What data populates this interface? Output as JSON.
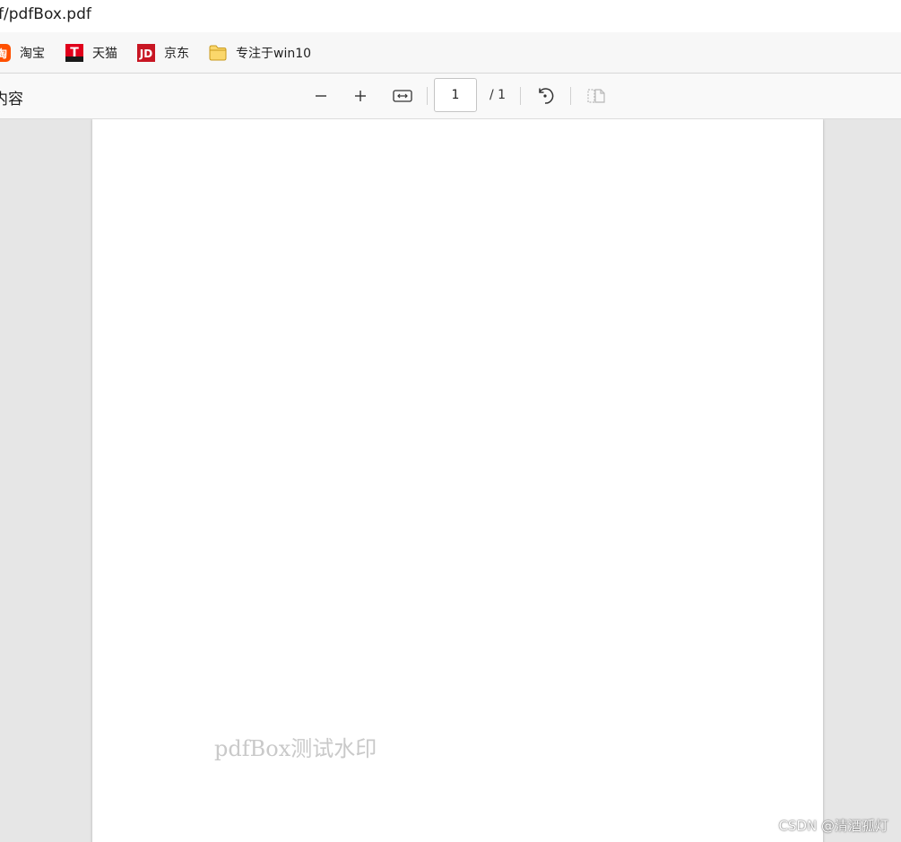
{
  "address_bar": {
    "url_fragment": "f/pdfBox.pdf"
  },
  "bookmarks": [
    {
      "label": "淘宝",
      "icon": "taobao-icon",
      "color": "#ff5000"
    },
    {
      "label": "天猫",
      "icon": "tmall-icon",
      "color": "#e0001b"
    },
    {
      "label": "京东",
      "icon": "jd-icon",
      "color": "#c81623"
    },
    {
      "label": "专注于win10",
      "icon": "folder-icon",
      "color": "#f4c430"
    }
  ],
  "pdf_toolbar": {
    "outline_label": "内容",
    "page_current": "1",
    "page_total": "/ 1",
    "icons": [
      "zoom-out-icon",
      "zoom-in-icon",
      "fit-width-icon",
      "rotate-icon",
      "two-page-icon"
    ]
  },
  "document": {
    "watermark": "pdfBox测试水印"
  },
  "overlay": {
    "csdn_watermark": "CSDN @清酒孤灯"
  }
}
